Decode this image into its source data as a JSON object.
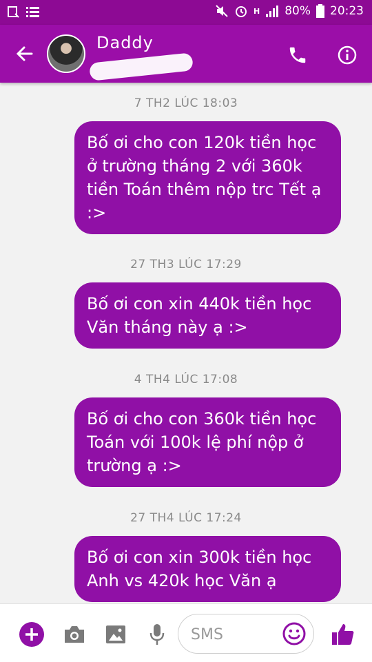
{
  "status": {
    "battery": "80%",
    "time": "20:23",
    "network": "H"
  },
  "header": {
    "contact_name": "Daddy"
  },
  "messages": [
    {
      "timestamp": "7 TH2 LÚC 18:03",
      "text": "Bố ơi cho con 120k tiền học ở trường tháng 2 với 360k tiền Toán thêm nộp trc Tết ạ :>"
    },
    {
      "timestamp": "27 TH3 LÚC 17:29",
      "text": "Bố ơi con xin 440k tiền học Văn tháng này ạ :>"
    },
    {
      "timestamp": "4 TH4 LÚC 17:08",
      "text": "Bố ơi cho con 360k tiền học Toán với 100k lệ phí nộp ở trường ạ :>"
    },
    {
      "timestamp": "27 TH4 LÚC 17:24",
      "text": "Bố ơi con xin 300k tiền học Anh vs 420k học Văn ạ"
    }
  ],
  "composer": {
    "placeholder": "SMS"
  },
  "colors": {
    "app_bar": "#9b0ea8",
    "status_bar": "#8d0a94",
    "bubble": "#9010a6",
    "accent": "#9010a6"
  },
  "icons": [
    "back-arrow-icon",
    "phone-icon",
    "info-icon",
    "plus-icon",
    "camera-icon",
    "image-icon",
    "mic-icon",
    "emoji-icon",
    "thumbs-up-icon"
  ]
}
